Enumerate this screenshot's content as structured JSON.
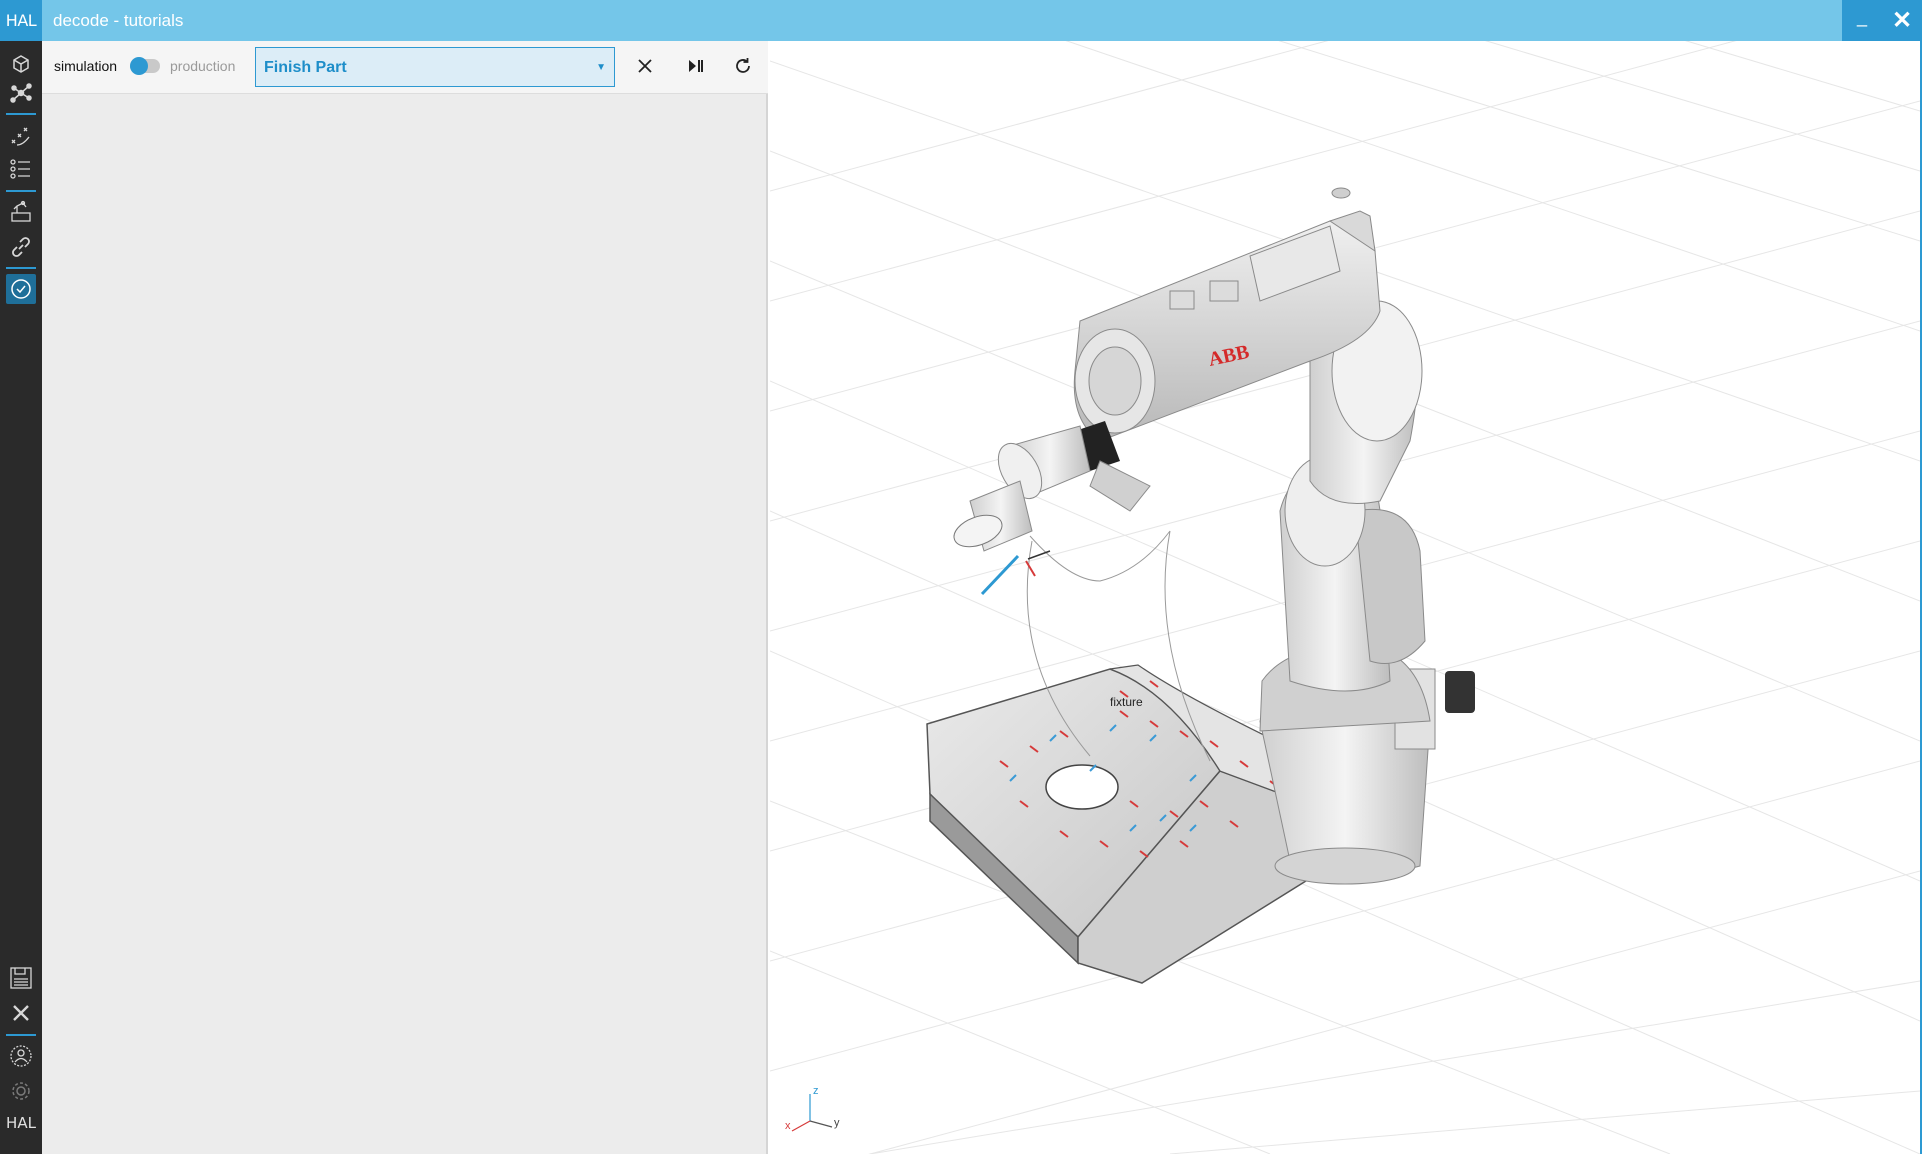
{
  "app": {
    "logo": "HAL",
    "title": "decode - tutorials",
    "minimize_label": "_",
    "close_label": "✕"
  },
  "sidebar": {
    "icons": [
      "cube-icon",
      "graph-nodes-icon",
      "path-points-icon",
      "list-icon",
      "robot-cell-icon",
      "link-icon",
      "check-circle-icon",
      "save-icon",
      "close-icon",
      "user-icon",
      "gear-icon"
    ],
    "footer_logo": "HAL"
  },
  "toolbar": {
    "mode_left": "simulation",
    "mode_right": "production",
    "procedure": {
      "selected": "Finish Part"
    },
    "cancel_icon": "cancel-icon",
    "step_icon": "step-forward-icon",
    "reset_icon": "reset-icon"
  },
  "viewport": {
    "robot_brand": "ABB",
    "fixture_label": "fixture",
    "axes": {
      "z": "z",
      "y": "y",
      "x": "x"
    }
  },
  "colors": {
    "accent": "#2d99d2",
    "titlebar": "#74c6e9",
    "sidebar": "#2a2a2a",
    "panel": "#ececec"
  }
}
